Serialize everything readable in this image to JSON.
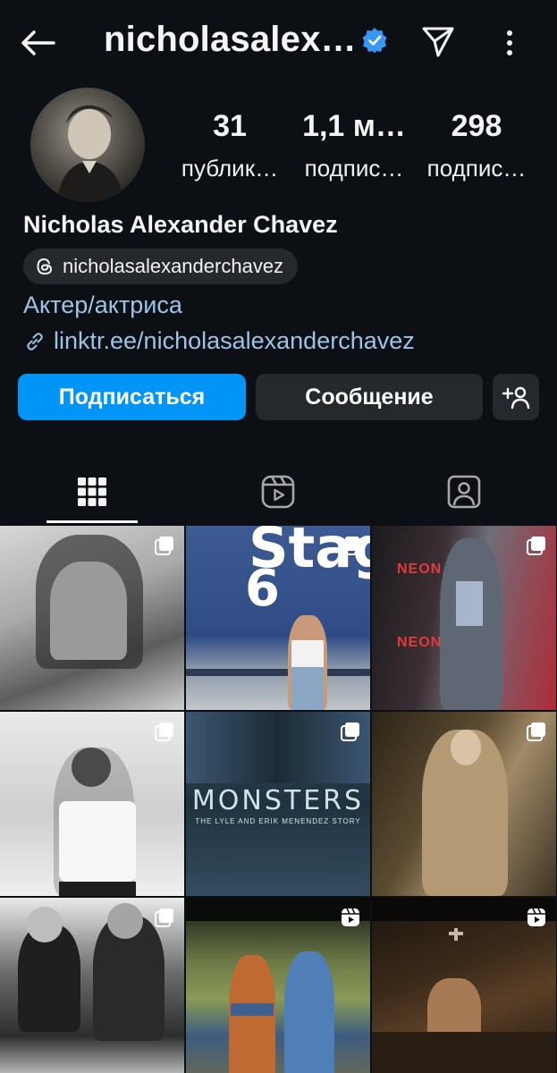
{
  "header": {
    "username": "nicholasalex…",
    "back_icon": "arrow-left-icon",
    "verified_icon": "verified-badge-icon",
    "send_icon": "paper-plane-icon",
    "more_icon": "vertical-dots-icon"
  },
  "profile": {
    "avatar_icon": "profile-photo",
    "stats": [
      {
        "value": "31",
        "label": "публик…"
      },
      {
        "value": "1,1 м…",
        "label": "подпис…"
      },
      {
        "value": "298",
        "label": "подпис…"
      }
    ],
    "full_name": "Nicholas Alexander Chavez",
    "threads_handle": "nicholasalexanderchavez",
    "category": "Актер/актриса",
    "link": "linktr.ee/nicholasalexanderchavez"
  },
  "actions": {
    "follow_label": "Подписаться",
    "message_label": "Сообщение",
    "add_user_icon": "add-user-icon"
  },
  "tabs": {
    "grid_icon": "grid-icon",
    "reels_icon": "reels-icon",
    "tagged_icon": "tagged-icon"
  },
  "posts": {
    "stage_word": "Stag",
    "stage_number": "6",
    "neon_word": "NEON",
    "monsters_title": "MONSTERS",
    "monsters_subtitle": "THE LYLE AND ERIK MENENDEZ STORY"
  },
  "colors": {
    "background": "#0c1014",
    "accent": "#0095f6",
    "secondary_button": "#25292e",
    "link": "#9fc3e6"
  }
}
